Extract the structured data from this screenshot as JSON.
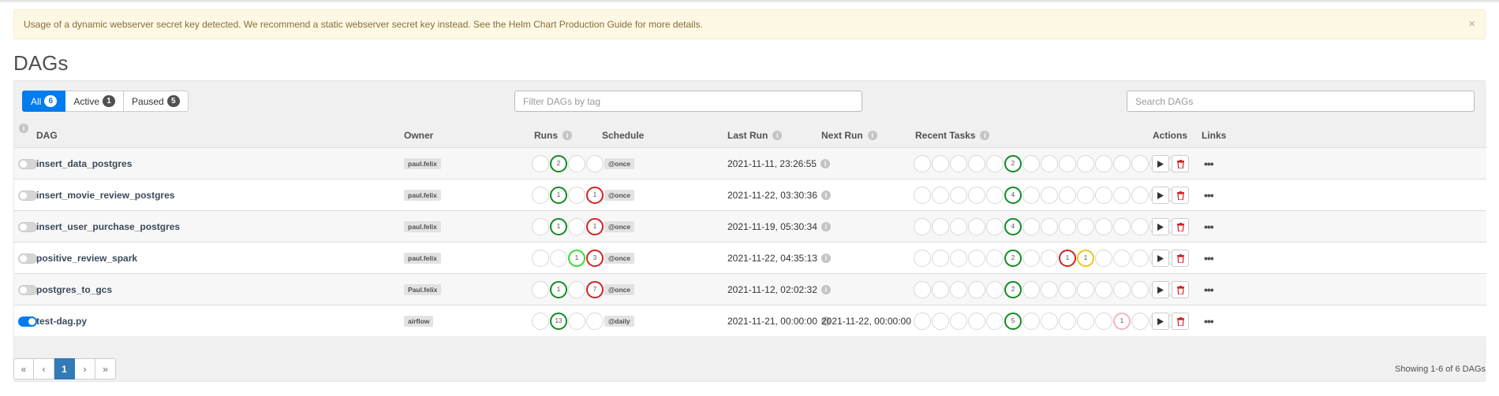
{
  "alert": {
    "text_before": "Usage of a dynamic webserver secret key detected. We recommend a static webserver secret key instead. See the ",
    "link": "Helm Chart Production Guide",
    "text_after": " for more details.",
    "close": "×"
  },
  "page_title": "DAGs",
  "filters": [
    {
      "label": "All",
      "count": "6",
      "active": true
    },
    {
      "label": "Active",
      "count": "1",
      "active": false
    },
    {
      "label": "Paused",
      "count": "5",
      "active": false
    }
  ],
  "tag_filter_placeholder": "Filter DAGs by tag",
  "search_placeholder": "Search DAGs",
  "columns": {
    "info": "i",
    "dag": "DAG",
    "owner": "Owner",
    "runs": "Runs",
    "schedule": "Schedule",
    "last_run": "Last Run",
    "next_run": "Next Run",
    "recent_tasks": "Recent Tasks",
    "actions": "Actions",
    "links": "Links"
  },
  "status_colors": {
    "green": "#118a22",
    "red": "#d42222",
    "lime": "#35dc35",
    "yellow": "#efc614",
    "pink": "#f5b4bc"
  },
  "dags": [
    {
      "name": "insert_data_postgres",
      "owner": "paul.felix",
      "active": false,
      "runs": [
        {
          "s": ""
        },
        {
          "s": "green",
          "n": "2"
        },
        {
          "s": ""
        },
        {
          "s": ""
        }
      ],
      "schedule": "@once",
      "last_run": "2021-11-11, 23:26:55",
      "next_run": "",
      "tasks": [
        {
          "s": ""
        },
        {
          "s": ""
        },
        {
          "s": ""
        },
        {
          "s": ""
        },
        {
          "s": ""
        },
        {
          "s": "green",
          "n": "2"
        },
        {
          "s": ""
        },
        {
          "s": ""
        },
        {
          "s": ""
        },
        {
          "s": ""
        },
        {
          "s": ""
        },
        {
          "s": ""
        },
        {
          "s": ""
        },
        {
          "s": ""
        },
        {
          "s": ""
        }
      ]
    },
    {
      "name": "insert_movie_review_postgres",
      "owner": "paul.felix",
      "active": false,
      "runs": [
        {
          "s": ""
        },
        {
          "s": "green",
          "n": "1"
        },
        {
          "s": ""
        },
        {
          "s": "red",
          "n": "1"
        }
      ],
      "schedule": "@once",
      "last_run": "2021-11-22, 03:30:36",
      "next_run": "",
      "tasks": [
        {
          "s": ""
        },
        {
          "s": ""
        },
        {
          "s": ""
        },
        {
          "s": ""
        },
        {
          "s": ""
        },
        {
          "s": "green",
          "n": "4"
        },
        {
          "s": ""
        },
        {
          "s": ""
        },
        {
          "s": ""
        },
        {
          "s": ""
        },
        {
          "s": ""
        },
        {
          "s": ""
        },
        {
          "s": ""
        },
        {
          "s": ""
        },
        {
          "s": ""
        }
      ]
    },
    {
      "name": "insert_user_purchase_postgres",
      "owner": "paul.felix",
      "active": false,
      "runs": [
        {
          "s": ""
        },
        {
          "s": "green",
          "n": "1"
        },
        {
          "s": ""
        },
        {
          "s": "red",
          "n": "1"
        }
      ],
      "schedule": "@once",
      "last_run": "2021-11-19, 05:30:34",
      "next_run": "",
      "tasks": [
        {
          "s": ""
        },
        {
          "s": ""
        },
        {
          "s": ""
        },
        {
          "s": ""
        },
        {
          "s": ""
        },
        {
          "s": "green",
          "n": "4"
        },
        {
          "s": ""
        },
        {
          "s": ""
        },
        {
          "s": ""
        },
        {
          "s": ""
        },
        {
          "s": ""
        },
        {
          "s": ""
        },
        {
          "s": ""
        },
        {
          "s": ""
        },
        {
          "s": ""
        }
      ]
    },
    {
      "name": "positive_review_spark",
      "owner": "paul.felix",
      "active": false,
      "runs": [
        {
          "s": ""
        },
        {
          "s": ""
        },
        {
          "s": "lime",
          "n": "1"
        },
        {
          "s": "red",
          "n": "3"
        }
      ],
      "schedule": "@once",
      "last_run": "2021-11-22, 04:35:13",
      "next_run": "",
      "tasks": [
        {
          "s": ""
        },
        {
          "s": ""
        },
        {
          "s": ""
        },
        {
          "s": ""
        },
        {
          "s": ""
        },
        {
          "s": "green",
          "n": "2"
        },
        {
          "s": ""
        },
        {
          "s": ""
        },
        {
          "s": "red",
          "n": "1"
        },
        {
          "s": "yellow",
          "n": "1"
        },
        {
          "s": ""
        },
        {
          "s": ""
        },
        {
          "s": ""
        },
        {
          "s": ""
        },
        {
          "s": ""
        }
      ]
    },
    {
      "name": "postgres_to_gcs",
      "owner": "Paul.felix",
      "active": false,
      "runs": [
        {
          "s": ""
        },
        {
          "s": "green",
          "n": "1"
        },
        {
          "s": ""
        },
        {
          "s": "red",
          "n": "7"
        }
      ],
      "schedule": "@once",
      "last_run": "2021-11-12, 02:02:32",
      "next_run": "",
      "tasks": [
        {
          "s": ""
        },
        {
          "s": ""
        },
        {
          "s": ""
        },
        {
          "s": ""
        },
        {
          "s": ""
        },
        {
          "s": "green",
          "n": "2"
        },
        {
          "s": ""
        },
        {
          "s": ""
        },
        {
          "s": ""
        },
        {
          "s": ""
        },
        {
          "s": ""
        },
        {
          "s": ""
        },
        {
          "s": ""
        },
        {
          "s": ""
        },
        {
          "s": ""
        }
      ]
    },
    {
      "name": "test-dag.py",
      "owner": "airflow",
      "active": true,
      "runs": [
        {
          "s": ""
        },
        {
          "s": "green",
          "n": "13"
        },
        {
          "s": ""
        },
        {
          "s": ""
        }
      ],
      "schedule": "@daily",
      "last_run": "2021-11-21, 00:00:00",
      "next_run": "2021-11-22, 00:00:00",
      "tasks": [
        {
          "s": ""
        },
        {
          "s": ""
        },
        {
          "s": ""
        },
        {
          "s": ""
        },
        {
          "s": ""
        },
        {
          "s": "green",
          "n": "5"
        },
        {
          "s": ""
        },
        {
          "s": ""
        },
        {
          "s": ""
        },
        {
          "s": ""
        },
        {
          "s": ""
        },
        {
          "s": "pink",
          "n": "1"
        },
        {
          "s": ""
        },
        {
          "s": ""
        },
        {
          "s": ""
        }
      ]
    }
  ],
  "action_icons": {
    "trigger": "play-icon",
    "delete": "trash-icon"
  },
  "links_label": "•••",
  "pagination": {
    "first": "«",
    "prev": "‹",
    "current": "1",
    "next": "›",
    "last": "»"
  },
  "showing_text": "Showing 1-6 of 6 DAGs"
}
